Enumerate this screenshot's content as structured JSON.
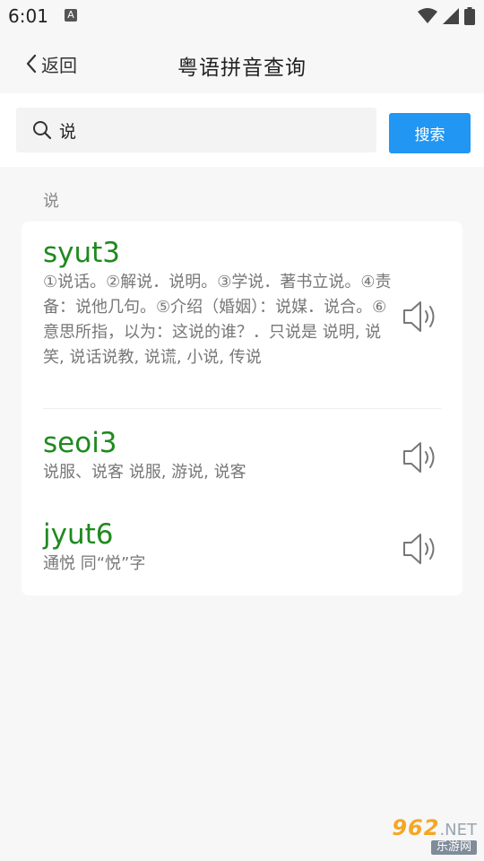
{
  "status_bar": {
    "time": "6:01",
    "notification_glyph": "A",
    "icons": [
      "wifi-icon",
      "signal-icon",
      "battery-icon"
    ]
  },
  "header": {
    "back_label": "返回",
    "title": "粤语拼音查询"
  },
  "search": {
    "value": "说",
    "button_label": "搜索"
  },
  "query_label": "说",
  "results": [
    {
      "jyutping": "syut3",
      "meaning": "①说话。②解说．说明。③学说．著书立说。④责备：说他几句。⑤介绍（婚姻）：说媒．说合。⑥意思所指，以为：这说的谁？．只说是 说明, 说笑, 说话说教, 说谎, 小说, 传说"
    },
    {
      "jyutping": "seoi3",
      "meaning": "说服、说客 说服, 游说, 说客"
    },
    {
      "jyutping": "jyut6",
      "meaning": "通悦 同“悦”字"
    }
  ],
  "watermark": {
    "number": "962",
    "suffix": ".NET",
    "subtitle": "乐游网"
  },
  "colors": {
    "accent": "#2196f3",
    "jyutping_green": "#1e8a1e",
    "meaning_gray": "#777777",
    "background": "#f7f7f7"
  }
}
